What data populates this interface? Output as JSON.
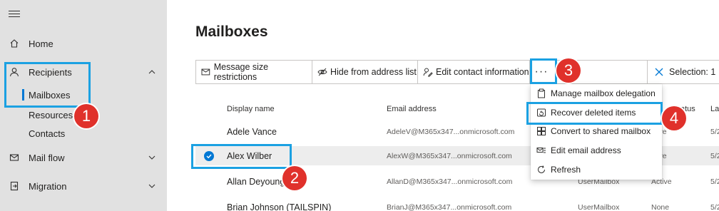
{
  "sidebar": {
    "items": [
      {
        "label": "Home",
        "icon": "home-icon",
        "expandable": false
      },
      {
        "label": "Recipients",
        "icon": "person-icon",
        "expandable": true,
        "expanded": true
      },
      {
        "label": "Mailboxes",
        "sub": true,
        "active": true
      },
      {
        "label": "Resources",
        "sub": true
      },
      {
        "label": "Contacts",
        "sub": true
      },
      {
        "label": "Mail flow",
        "icon": "mail-icon",
        "expandable": true
      },
      {
        "label": "Migration",
        "icon": "migration-icon",
        "expandable": true
      }
    ]
  },
  "page": {
    "title": "Mailboxes"
  },
  "toolbar": {
    "msg_size_label": "Message size restrictions",
    "hide_label": "Hide from address list",
    "edit_contact_label": "Edit contact information",
    "more_label": "···",
    "selection_label": "Selection: 1"
  },
  "table": {
    "headers": {
      "display_name": "Display name",
      "email": "Email address",
      "status": "atus",
      "last": "La"
    },
    "rows": [
      {
        "name": "Adele Vance",
        "email": "AdeleV@M365x347...onmicrosoft.com",
        "type": "",
        "status": "ctive",
        "date": "5/2"
      },
      {
        "name": "Alex Wilber",
        "email": "AlexW@M365x347...onmicrosoft.com",
        "type": "",
        "status": "ctive",
        "date": "5/2",
        "selected": true
      },
      {
        "name": "Allan Deyoung",
        "email": "AllanD@M365x347...onmicrosoft.com",
        "type": "UserMailbox",
        "status": "Active",
        "date": "5/2"
      },
      {
        "name": "Brian Johnson (TAILSPIN)",
        "email": "BrianJ@M365x347...onmicrosoft.com",
        "type": "UserMailbox",
        "status": "None",
        "date": "5/2"
      }
    ]
  },
  "menu": {
    "items": [
      {
        "label": "Manage mailbox delegation",
        "icon": "clipboard-icon"
      },
      {
        "label": "Recover deleted items",
        "icon": "recover-icon"
      },
      {
        "label": "Convert to shared mailbox",
        "icon": "convert-icon"
      },
      {
        "label": "Edit email address",
        "icon": "edit-email-icon"
      },
      {
        "label": "Refresh",
        "icon": "refresh-icon"
      }
    ]
  },
  "callouts": [
    "1",
    "2",
    "3",
    "4"
  ],
  "colors": {
    "accent": "#0078d4",
    "callout": "#1ba1e2",
    "badge": "#e0312b",
    "sidebar": "#e1e1e1"
  }
}
